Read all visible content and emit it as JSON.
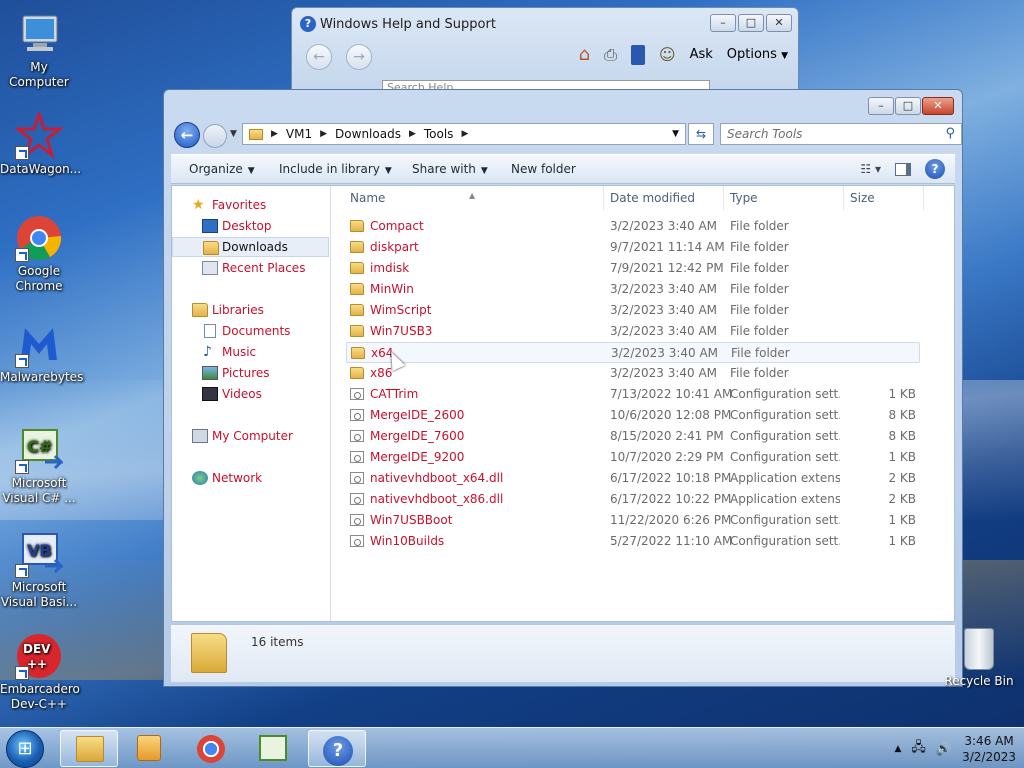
{
  "desktop_icons": [
    {
      "label": "My Computer"
    },
    {
      "label": "DataWagon..."
    },
    {
      "label": "Google Chrome"
    },
    {
      "label": "Malwarebytes"
    },
    {
      "label": "Microsoft Visual C# ..."
    },
    {
      "label": "Microsoft Visual Basi..."
    },
    {
      "label": "Embarcadero Dev-C++"
    }
  ],
  "recycle_bin": {
    "label": "Recycle Bin"
  },
  "help_window": {
    "title": "Windows Help and Support",
    "ask_label": "Ask",
    "options_label": "Options",
    "search_placeholder": "Search Help"
  },
  "explorer": {
    "breadcrumb": [
      "VM1",
      "Downloads",
      "Tools"
    ],
    "search_placeholder": "Search Tools",
    "toolbar": {
      "organize": "Organize",
      "include_in_library": "Include in library",
      "share_with": "Share with",
      "new_folder": "New folder"
    },
    "nav": {
      "favorites": "Favorites",
      "desktop": "Desktop",
      "downloads": "Downloads",
      "recent_places": "Recent Places",
      "libraries": "Libraries",
      "documents": "Documents",
      "music": "Music",
      "pictures": "Pictures",
      "videos": "Videos",
      "my_computer": "My Computer",
      "network": "Network"
    },
    "columns": {
      "name": "Name",
      "date": "Date modified",
      "type": "Type",
      "size": "Size"
    },
    "files": [
      {
        "name": "Compact",
        "date": "3/2/2023 3:40 AM",
        "type": "File folder",
        "size": "",
        "kind": "folder"
      },
      {
        "name": "diskpart",
        "date": "9/7/2021 11:14 AM",
        "type": "File folder",
        "size": "",
        "kind": "folder"
      },
      {
        "name": "imdisk",
        "date": "7/9/2021 12:42 PM",
        "type": "File folder",
        "size": "",
        "kind": "folder"
      },
      {
        "name": "MinWin",
        "date": "3/2/2023 3:40 AM",
        "type": "File folder",
        "size": "",
        "kind": "folder"
      },
      {
        "name": "WimScript",
        "date": "3/2/2023 3:40 AM",
        "type": "File folder",
        "size": "",
        "kind": "folder"
      },
      {
        "name": "Win7USB3",
        "date": "3/2/2023 3:40 AM",
        "type": "File folder",
        "size": "",
        "kind": "folder"
      },
      {
        "name": "x64",
        "date": "3/2/2023 3:40 AM",
        "type": "File folder",
        "size": "",
        "kind": "folder"
      },
      {
        "name": "x86",
        "date": "3/2/2023 3:40 AM",
        "type": "File folder",
        "size": "",
        "kind": "folder"
      },
      {
        "name": "CATTrim",
        "date": "7/13/2022 10:41 AM",
        "type": "Configuration sett...",
        "size": "1 KB",
        "kind": "cfg"
      },
      {
        "name": "MergeIDE_2600",
        "date": "10/6/2020 12:08 PM",
        "type": "Configuration sett...",
        "size": "8 KB",
        "kind": "cfg"
      },
      {
        "name": "MergeIDE_7600",
        "date": "8/15/2020 2:41 PM",
        "type": "Configuration sett...",
        "size": "8 KB",
        "kind": "cfg"
      },
      {
        "name": "MergeIDE_9200",
        "date": "10/7/2020 2:29 PM",
        "type": "Configuration sett...",
        "size": "1 KB",
        "kind": "cfg"
      },
      {
        "name": "nativevhdboot_x64.dll",
        "date": "6/17/2022 10:18 PM",
        "type": "Application extens...",
        "size": "2 KB",
        "kind": "cfg"
      },
      {
        "name": "nativevhdboot_x86.dll",
        "date": "6/17/2022 10:22 PM",
        "type": "Application extens...",
        "size": "2 KB",
        "kind": "cfg"
      },
      {
        "name": "Win7USBBoot",
        "date": "11/22/2020 6:26 PM",
        "type": "Configuration sett...",
        "size": "1 KB",
        "kind": "cfg"
      },
      {
        "name": "Win10Builds",
        "date": "5/27/2022 11:10 AM",
        "type": "Configuration sett...",
        "size": "1 KB",
        "kind": "cfg"
      }
    ],
    "items_count": "16 items"
  },
  "taskbar": {
    "time": "3:46 AM",
    "date": "3/2/2023"
  },
  "colors": {
    "link_red": "#c8102e",
    "accent_blue": "#1c58c5"
  }
}
